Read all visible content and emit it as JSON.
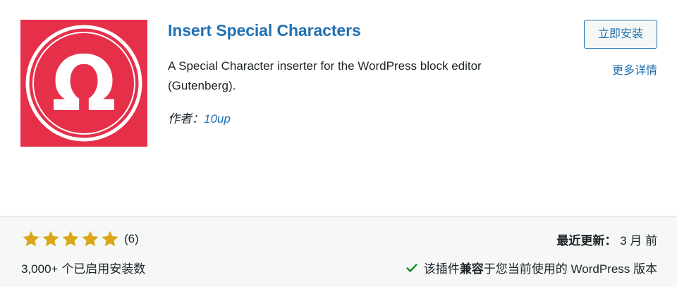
{
  "plugin": {
    "title": "Insert Special Characters",
    "description": "A Special Character inserter for the WordPress block editor (Gutenberg).",
    "author_label": "作者：",
    "author_name": "10up",
    "icon_glyph": "Ω",
    "icon_bg": "#e63049"
  },
  "actions": {
    "install_label": "立即安装",
    "details_label": "更多详情"
  },
  "footer": {
    "rating_stars": 5,
    "rating_count": "(6)",
    "installs": "3,000+ 个已启用安装数",
    "updated_label": "最近更新：",
    "updated_value": "3 月 前",
    "compat_prefix": "该插件",
    "compat_bold": "兼容",
    "compat_suffix": "于您当前使用的 WordPress 版本"
  },
  "colors": {
    "accent": "#2271b1",
    "star": "#dba617",
    "check": "#008a20"
  }
}
